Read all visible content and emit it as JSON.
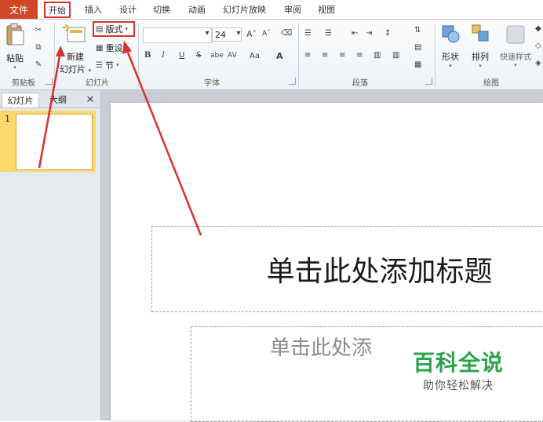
{
  "menu": {
    "file": "文件",
    "tabs": [
      "开始",
      "插入",
      "设计",
      "切换",
      "动画",
      "幻灯片放映",
      "审阅",
      "视图"
    ]
  },
  "ribbon": {
    "clipboard": {
      "paste": "粘贴",
      "label": "剪贴板"
    },
    "slides": {
      "new_slide_1": "新建",
      "new_slide_2": "幻灯片",
      "layout": "版式",
      "reset": "重设",
      "section": "节",
      "label": "幻灯片"
    },
    "font": {
      "size": "24",
      "label": "字体",
      "bold": "B",
      "italic": "I",
      "underline": "U",
      "strike": "S",
      "shadow": "abe",
      "spacing": "AV",
      "case": "Aa",
      "color": "A",
      "grow": "A",
      "shrink": "A"
    },
    "paragraph": {
      "label": "段落"
    },
    "drawing": {
      "shapes": "形状",
      "arrange": "排列",
      "quick_styles": "快速样式",
      "label": "绘图"
    }
  },
  "left_panel": {
    "tab_slides": "幻灯片",
    "tab_outline": "大纲",
    "close": "✕",
    "slide_number": "1"
  },
  "slide": {
    "title_placeholder": "单击此处添加标题",
    "subtitle_placeholder": "单击此处添"
  },
  "watermark": {
    "title": "百科全说",
    "subtitle": "助你轻松解决"
  },
  "colors": {
    "file_tab": "#d24726",
    "annotation_red": "#d9322a",
    "selected_thumb": "#fbd96a",
    "watermark_green": "#2ba24c"
  }
}
